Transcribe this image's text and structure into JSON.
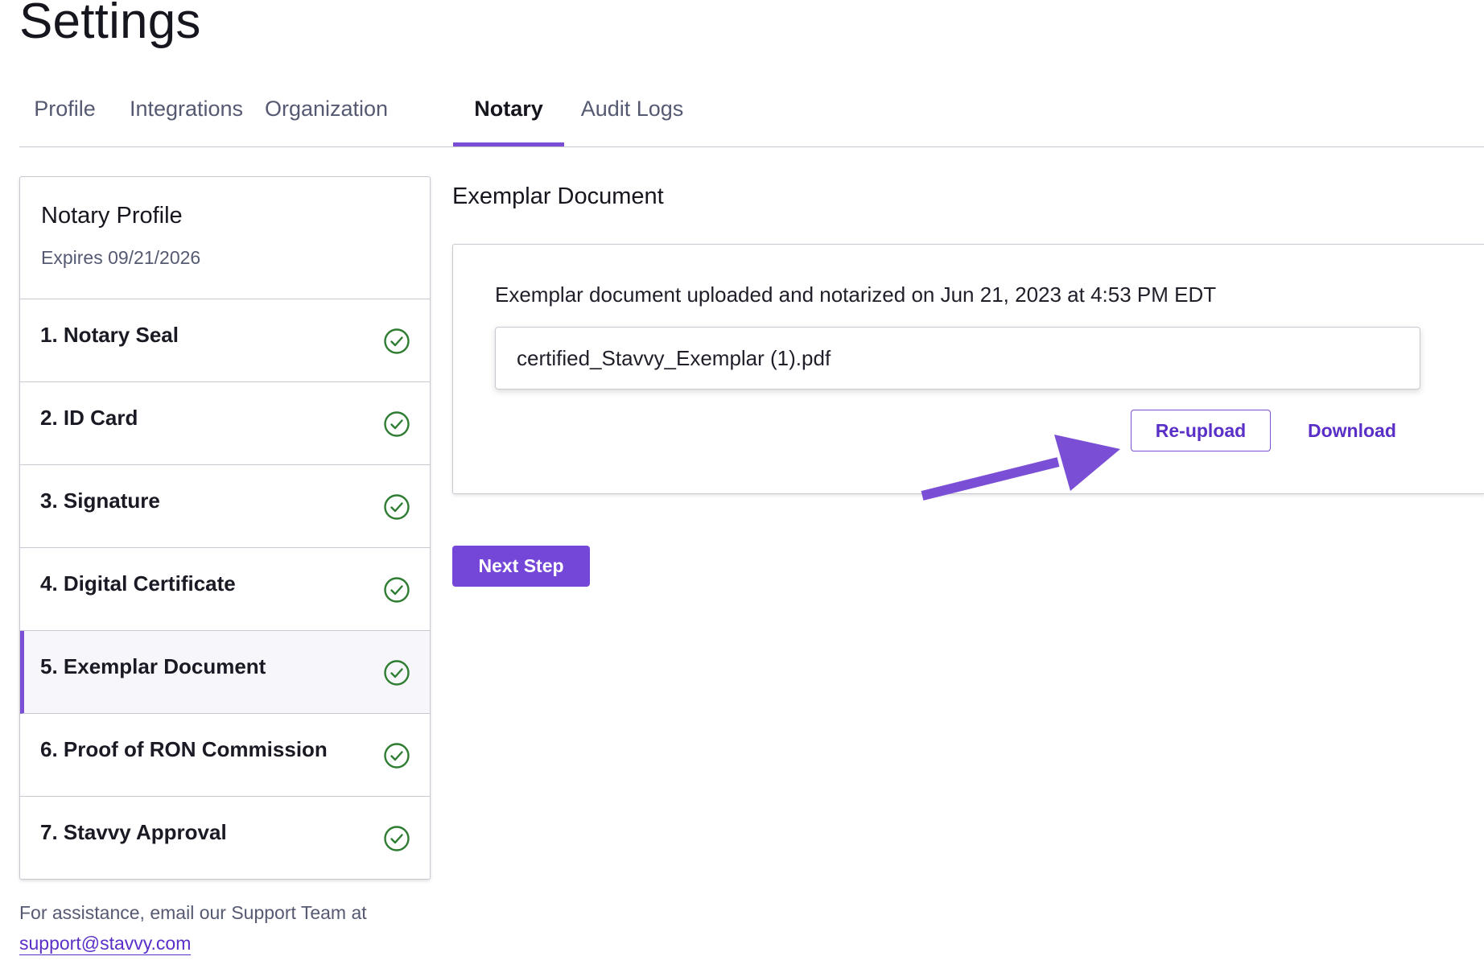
{
  "page": {
    "title": "Settings"
  },
  "tabs": [
    {
      "label": "Profile"
    },
    {
      "label": "Integrations"
    },
    {
      "label": "Organization"
    },
    {
      "label": "Notary"
    },
    {
      "label": "Audit Logs"
    }
  ],
  "active_tab": "Notary",
  "sidebar": {
    "profile_title": "Notary Profile",
    "profile_expires": "Expires 09/21/2026",
    "steps": [
      {
        "label": "1. Notary Seal",
        "status": "complete"
      },
      {
        "label": "2. ID Card",
        "status": "complete"
      },
      {
        "label": "3. Signature",
        "status": "complete"
      },
      {
        "label": "4. Digital Certificate",
        "status": "complete"
      },
      {
        "label": "5. Exemplar Document",
        "status": "complete"
      },
      {
        "label": "6. Proof of RON Commission",
        "status": "complete"
      },
      {
        "label": "7. Stavvy Approval",
        "status": "complete"
      }
    ],
    "active_step": "5. Exemplar Document",
    "help_text": "For assistance, email our Support Team at",
    "help_email": "support@stavvy.com"
  },
  "main": {
    "section_title": "Exemplar Document",
    "uploaded_text": "Exemplar document uploaded and notarized on Jun 21, 2023 at 4:53 PM EDT",
    "file_name": "certified_Stavvy_Exemplar (1).pdf",
    "reupload_label": "Re-upload",
    "download_label": "Download",
    "next_label": "Next Step"
  },
  "icons": {
    "step_status": "check-circle-icon",
    "annotation": "arrow-icon"
  },
  "colors": {
    "accent": "#7a4fd6",
    "link": "#5a2fc8",
    "success": "#2e7d32",
    "primary_button": "#7547d9"
  }
}
